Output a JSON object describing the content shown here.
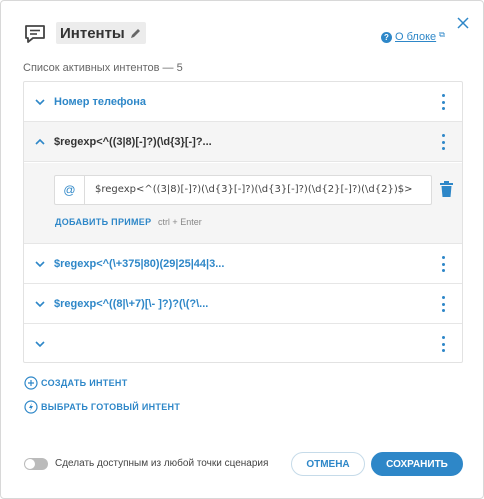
{
  "header": {
    "title": "Интенты",
    "about_label": "О блоке",
    "help_icon_glyph": "?",
    "external_icon_glyph": "⧉"
  },
  "subtitle": "Список активных интентов — 5",
  "intents": [
    {
      "label": "Номер телефона",
      "expanded": false
    },
    {
      "label": "$regexp<^((3|8)[-]?)(\\d{3}[-]?...",
      "expanded": true
    },
    {
      "label": "$regexp<^(\\+375|80)(29|25|44|3...",
      "expanded": false
    },
    {
      "label": "$regexp<^((8|\\+7)[\\- ]?)?(\\(?\\...",
      "expanded": false
    },
    {
      "label": "",
      "expanded": false
    }
  ],
  "example": {
    "at_glyph": "@",
    "text": "$regexp<^((3|8)[-]?)(\\d{3}[-]?)(\\d{3}[-]?)(\\d{2}[-]?)(\\d{2})$>",
    "add_label": "ДОБАВИТЬ ПРИМЕР",
    "add_hint": "ctrl + Enter"
  },
  "actions": {
    "create": "СОЗДАТЬ ИНТЕНТ",
    "choose": "ВЫБРАТЬ ГОТОВЫЙ ИНТЕНТ"
  },
  "footer": {
    "toggle_label": "Сделать доступным из любой точки сценария",
    "toggle_on": false,
    "cancel": "ОТМЕНА",
    "save": "СОХРАНИТЬ"
  },
  "colors": {
    "accent": "#2e87c8",
    "text": "#333333",
    "border": "#e2e2e2"
  }
}
